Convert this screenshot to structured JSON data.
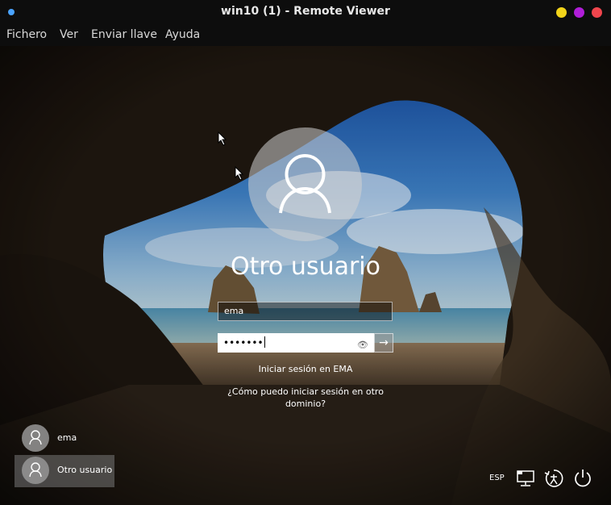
{
  "window": {
    "title": "win10 (1) - Remote Viewer"
  },
  "menu": [
    "Fichero",
    "Ver",
    "Enviar llave",
    "Ayuda"
  ],
  "login": {
    "display_name": "Otro usuario",
    "username_value": "ema",
    "password_mask": "•••••••",
    "sign_in_link": "Iniciar sesión en EMA",
    "other_domain_link": "¿Cómo puedo iniciar sesión en otro dominio?"
  },
  "users": [
    {
      "name": "ema",
      "selected": false
    },
    {
      "name": "Otro usuario",
      "selected": true
    }
  ],
  "tray": {
    "language": "ESP"
  },
  "icons": [
    "user-avatar-icon",
    "password-reveal-icon",
    "submit-arrow-icon",
    "network-icon",
    "accessibility-icon",
    "power-icon",
    "mouse-cursor-icon"
  ],
  "colors": {
    "title_dot": "#4aa3ff",
    "minimize": "#f2d41a",
    "maximize": "#b01ed8",
    "close": "#f0454d"
  }
}
